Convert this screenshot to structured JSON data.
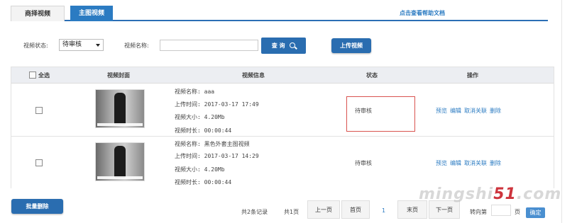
{
  "tabs": [
    {
      "label": "商择视频"
    },
    {
      "label": "主图视频"
    }
  ],
  "help_link": "点击查看帮助文档",
  "filter": {
    "status_label": "视频状态:",
    "status_value": "待审核",
    "name_label": "视频名称:",
    "name_value": "",
    "query_button": "查 询",
    "upload_button": "上传视频"
  },
  "table": {
    "headers": {
      "select_all": "全选",
      "cover": "视频封面",
      "info": "视频信息",
      "status": "状态",
      "ops": "操作"
    },
    "rows": [
      {
        "name": "视频名称: aaa",
        "upload_time": "上传时间: 2017-03-17 17:49",
        "size": "视频大小: 4.20Mb",
        "duration": "视频时长: 00:00:44",
        "status": "待审核",
        "ops": [
          "预览",
          "编辑",
          "取消关联",
          "删除"
        ]
      },
      {
        "name": "视频名称: 黑色外套主图视频",
        "upload_time": "上传时间: 2017-03-17 14:29",
        "size": "视频大小: 4.20Mb",
        "duration": "视频时长: 00:00:44",
        "status": "待审核",
        "ops": [
          "预览",
          "编辑",
          "取消关联",
          "删除"
        ]
      }
    ]
  },
  "footer": {
    "batch_delete": "批量删除",
    "total_records": "共2条记录",
    "total_pages": "共1页",
    "prev": "上一页",
    "first": "首页",
    "current": "1",
    "last": "末页",
    "next": "下一页",
    "goto_label": "转向第",
    "page_unit": "页",
    "confirm": "确定"
  },
  "watermark": {
    "text": "mingshi",
    "number": "51",
    "suffix": ".com"
  }
}
